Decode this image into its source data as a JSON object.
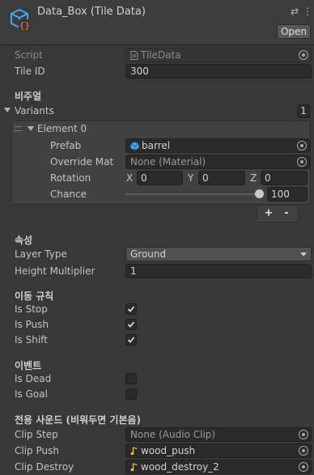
{
  "header": {
    "title": "Data_Box (Tile Data)",
    "open_label": "Open",
    "settings_glyph": "⇄",
    "menu_glyph": "⋮"
  },
  "fields": {
    "script_label": "Script",
    "script_value": "TileData",
    "tile_id_label": "Tile ID",
    "tile_id_value": "300"
  },
  "visual_section": {
    "header": "비주얼",
    "variants_label": "Variants",
    "variants_count": "1",
    "element_label": "Element 0",
    "prefab_label": "Prefab",
    "prefab_value": "barrel",
    "override_mat_label": "Override Mat",
    "override_mat_value": "None (Material)",
    "rotation_label": "Rotation",
    "rotation_x_label": "X",
    "rotation_x": "0",
    "rotation_y_label": "Y",
    "rotation_y": "0",
    "rotation_z_label": "Z",
    "rotation_z": "0",
    "chance_label": "Chance",
    "chance_value": "100",
    "add_label": "+",
    "remove_label": "-"
  },
  "attributes_section": {
    "header": "속성",
    "layer_type_label": "Layer Type",
    "layer_type_value": "Ground",
    "height_multiplier_label": "Height Multiplier",
    "height_multiplier_value": "1"
  },
  "movement_section": {
    "header": "이동 규칙",
    "is_stop_label": "Is Stop",
    "is_push_label": "Is Push",
    "is_shift_label": "Is Shift",
    "is_stop": true,
    "is_push": true,
    "is_shift": true
  },
  "event_section": {
    "header": "이벤트",
    "is_dead_label": "Is Dead",
    "is_goal_label": "Is Goal",
    "is_dead": false,
    "is_goal": false
  },
  "sound_section": {
    "header": "전용 사운드 (비워두면 기본음)",
    "clip_step_label": "Clip Step",
    "clip_step_value": "None (Audio Clip)",
    "clip_push_label": "Clip Push",
    "clip_push_value": "wood_push",
    "clip_destroy_label": "Clip Destroy",
    "clip_destroy_value": "wood_destroy_2"
  },
  "colors": {
    "background": "#383838",
    "field": "#2a2a2a",
    "text": "#c4c4c4",
    "icon_accent": "#3fa9f5",
    "icon_script": "#e8603c",
    "audio_icon": "#e8b84a"
  }
}
